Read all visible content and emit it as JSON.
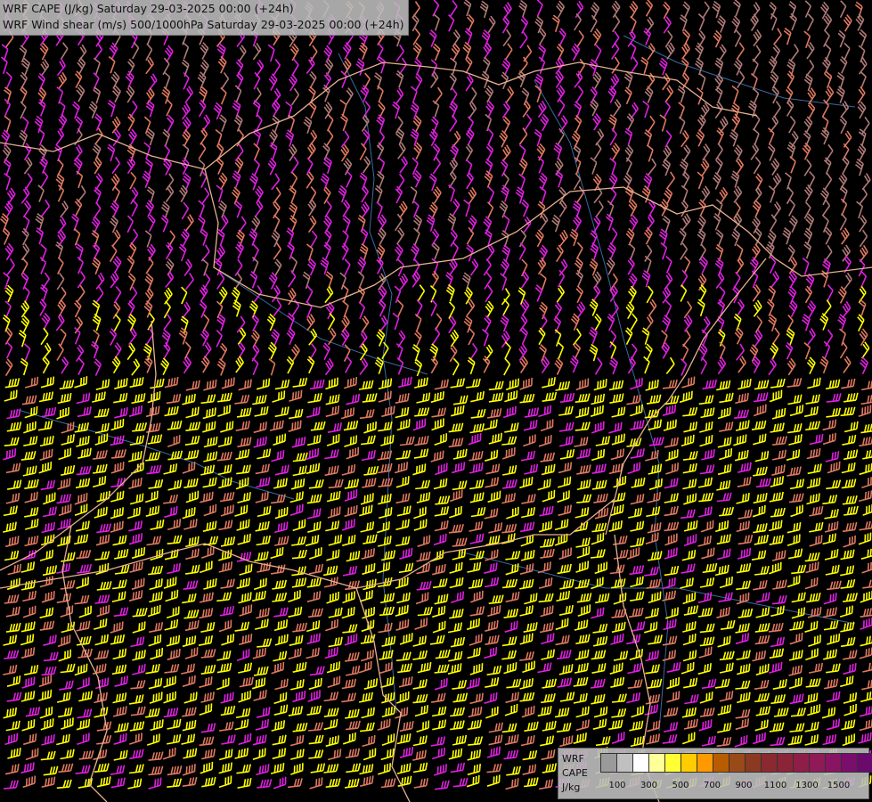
{
  "title": {
    "line1": "WRF CAPE (J/kg) Saturday 29-03-2025 00:00 (+24h)",
    "line2": "WRF Wind shear (m/s) 500/1000hPa Saturday 29-03-2025 00:00 (+24h)"
  },
  "legend": {
    "model": "WRF",
    "variable": "CAPE",
    "unit": "J/kg",
    "swatch_colors": [
      "#9a9a9a",
      "#c0c0c0",
      "#ffffff",
      "#ffff99",
      "#ffff33",
      "#ffcc00",
      "#ff9900",
      "#b85c00",
      "#9a4a18",
      "#8a3a20",
      "#8a2a30",
      "#8c2438",
      "#8e1e48",
      "#901a58",
      "#8a1464",
      "#7a0e6c",
      "#6a0a6c"
    ],
    "ticks": [
      "100",
      "300",
      "500",
      "700",
      "900",
      "1100",
      "1300",
      "1500"
    ]
  },
  "map": {
    "barb_colors": {
      "weak": "#b07a78",
      "light": "#e07860",
      "moderate": "#f0a0a0",
      "strong": "#e020e0",
      "very_strong": "#ffff00"
    },
    "border_color": "#e8b090",
    "river_color": "#3a6aa0"
  }
}
